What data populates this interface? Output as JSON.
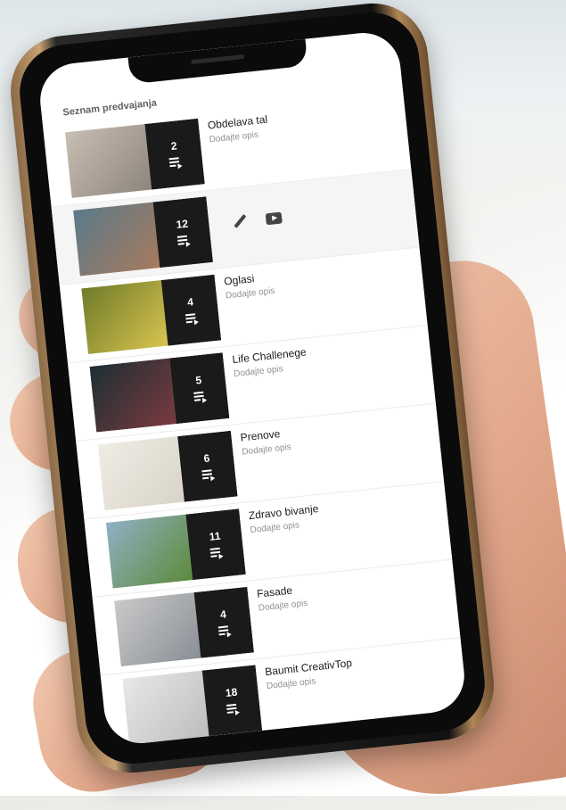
{
  "playlist": {
    "heading": "Seznam predvajanja",
    "items": [
      {
        "title": "Obdelava tal",
        "description": "Dodajte opis",
        "count": "2",
        "thumb_colors": [
          "#c8beb3",
          "#8e857c"
        ]
      },
      {
        "title": "",
        "description": "",
        "count": "12",
        "thumb_colors": [
          "#5b7a8a",
          "#a77a5e"
        ]
      },
      {
        "title": "Oglasi",
        "description": "Dodajte opis",
        "count": "4",
        "thumb_colors": [
          "#6f7a2a",
          "#d8c44e"
        ]
      },
      {
        "title": "Life Challenege",
        "description": "Dodajte opis",
        "count": "5",
        "thumb_colors": [
          "#1c2f33",
          "#7a3a3f"
        ]
      },
      {
        "title": "Prenove",
        "description": "Dodajte opis",
        "count": "6",
        "thumb_colors": [
          "#efece4",
          "#d9d4c9"
        ]
      },
      {
        "title": "Zdravo bivanje",
        "description": "Dodajte opis",
        "count": "11",
        "thumb_colors": [
          "#8fb1c4",
          "#5d8a3a"
        ]
      },
      {
        "title": "Fasade",
        "description": "Dodajte opis",
        "count": "4",
        "thumb_colors": [
          "#c9c9c9",
          "#8a8f96"
        ]
      },
      {
        "title": "Baumit CreativTop",
        "description": "Dodajte opis",
        "count": "18",
        "thumb_colors": [
          "#e8e8e8",
          "#bdbdbd"
        ]
      }
    ]
  }
}
